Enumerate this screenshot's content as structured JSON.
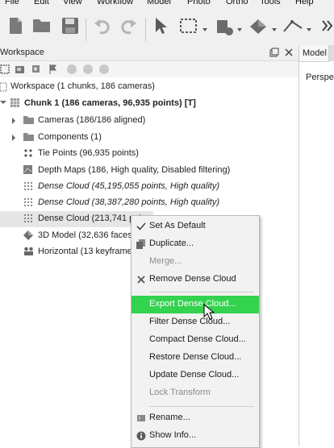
{
  "menubar": {
    "items": [
      "File",
      "Edit",
      "View",
      "Workflow",
      "Model",
      "Photo",
      "Ortho",
      "Tools",
      "Help"
    ]
  },
  "toolbar": {
    "icons": [
      "new-document-icon",
      "open-folder-icon",
      "save-icon",
      "undo-icon",
      "redo-icon",
      "pointer-icon",
      "rectangle-selection-icon",
      "brush-selection-icon",
      "navigation-icon",
      "ruler-icon",
      "more-icon"
    ]
  },
  "workspace": {
    "title": "Workspace",
    "root": "Workspace (1 chunks, 186 cameras)",
    "chunk": "Chunk 1 (186 cameras, 96,935 points) [T]",
    "items": [
      {
        "label": "Cameras (186/186 aligned)",
        "style": "normal"
      },
      {
        "label": "Components (1)",
        "style": "normal"
      },
      {
        "label": "Tie Points (96,935 points)",
        "style": "normal"
      },
      {
        "label": "Depth Maps (186, High quality, Disabled filtering)",
        "style": "normal"
      },
      {
        "label": "Dense Cloud (45,195,055 points, High quality)",
        "style": "italic"
      },
      {
        "label": "Dense Cloud (38,387,280 points, High quality)",
        "style": "italic"
      },
      {
        "label": "Dense Cloud (213,741 poi",
        "style": "normal"
      },
      {
        "label": "3D Model (32,636 faces, H",
        "style": "normal"
      },
      {
        "label": "Horizontal (13 keyframes)",
        "style": "normal"
      }
    ]
  },
  "right_panel": {
    "tab": "Model",
    "view_label": "Perspec"
  },
  "context_menu": {
    "items": [
      {
        "label": "Set As Default",
        "state": "checked"
      },
      {
        "label": "Duplicate...",
        "state": "normal"
      },
      {
        "label": "Merge...",
        "state": "disabled"
      },
      {
        "label": "Remove Dense Cloud",
        "state": "normal"
      },
      {
        "label": "Export Dense Cloud...",
        "state": "highlighted"
      },
      {
        "label": "Filter Dense Cloud...",
        "state": "normal"
      },
      {
        "label": "Compact Dense Cloud...",
        "state": "normal"
      },
      {
        "label": "Restore Dense Cloud...",
        "state": "normal"
      },
      {
        "label": "Update Dense Cloud...",
        "state": "normal"
      },
      {
        "label": "Lock Transform",
        "state": "disabled"
      },
      {
        "label": "Rename...",
        "state": "normal"
      },
      {
        "label": "Show Info...",
        "state": "normal"
      }
    ]
  },
  "colors": {
    "highlight": "#33d24f",
    "menu_bg": "#f2f2f2",
    "toolbar_bg": "#f0f0f0"
  }
}
